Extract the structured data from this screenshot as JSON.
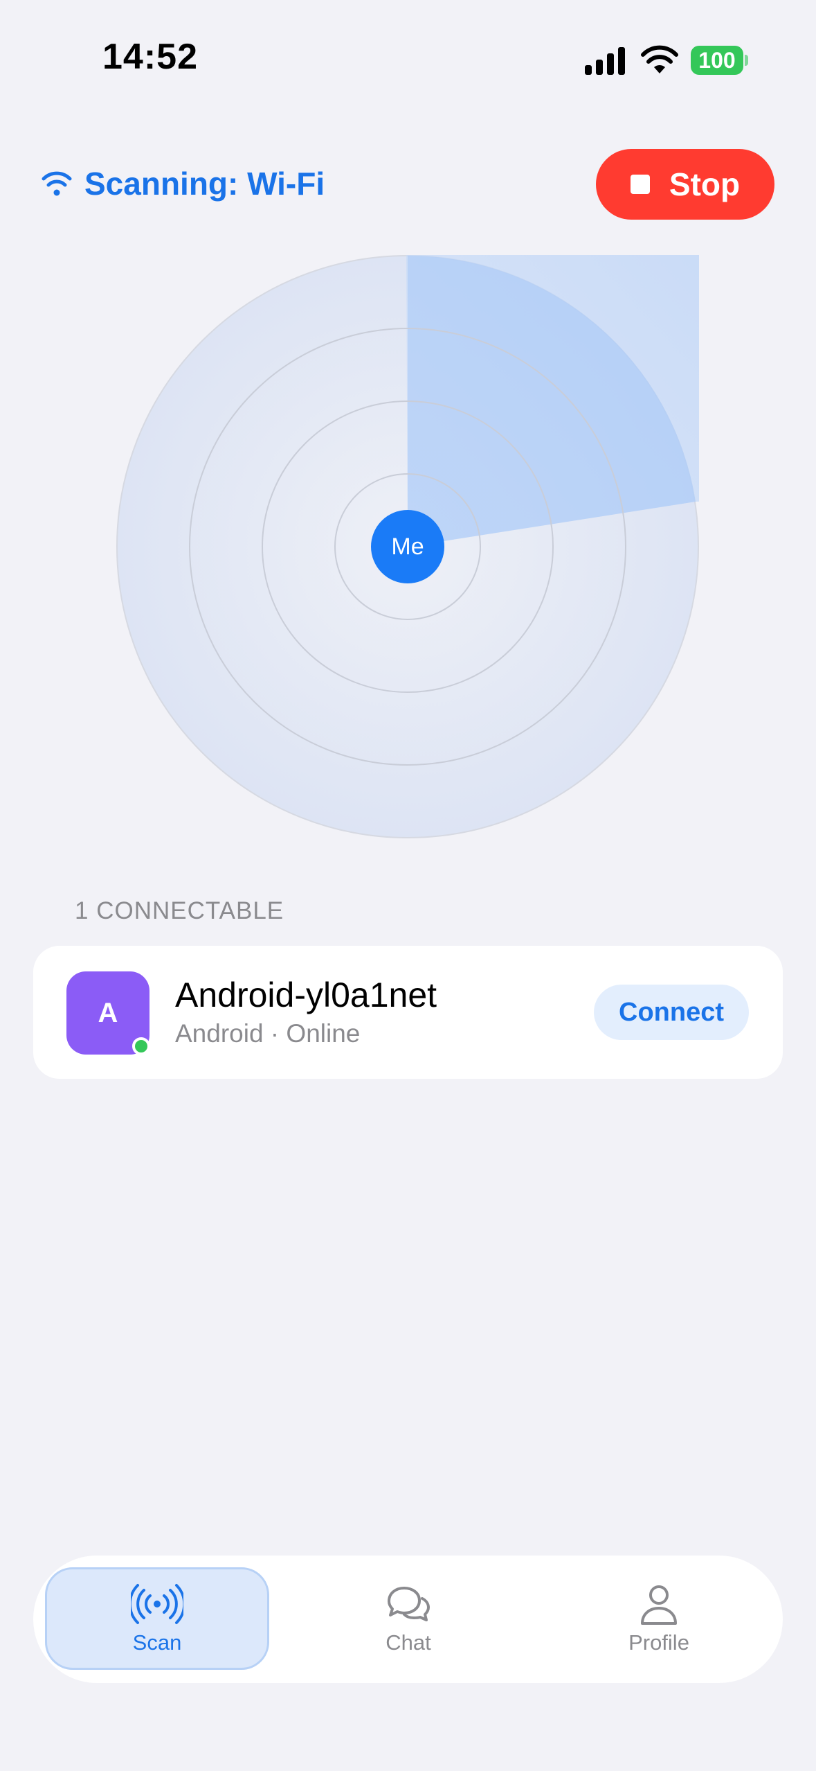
{
  "status_bar": {
    "time": "14:52",
    "battery": "100",
    "icons": [
      "signal-icon",
      "wifi-icon",
      "battery-icon"
    ]
  },
  "header": {
    "scan_status": "Scanning: Wi-Fi",
    "scan_icon": "wifi-icon",
    "stop_label": "Stop",
    "stop_icon": "stop-square-icon"
  },
  "radar": {
    "center_label": "Me"
  },
  "devices": {
    "section_title": "1 CONNECTABLE",
    "items": [
      {
        "avatar_letter": "A",
        "name": "Android-yl0a1net",
        "subtitle": "Android · Online",
        "status": "online",
        "action_label": "Connect"
      }
    ]
  },
  "tab_bar": {
    "tabs": [
      {
        "label": "Scan",
        "icon": "radio-waves-icon",
        "active": true
      },
      {
        "label": "Chat",
        "icon": "chat-bubbles-icon",
        "active": false
      },
      {
        "label": "Profile",
        "icon": "person-icon",
        "active": false
      }
    ]
  },
  "colors": {
    "accent": "#1A73E8",
    "stop": "#FF3B30",
    "online": "#34C759",
    "avatar": "#8B5CF6",
    "background": "#F2F2F7"
  }
}
